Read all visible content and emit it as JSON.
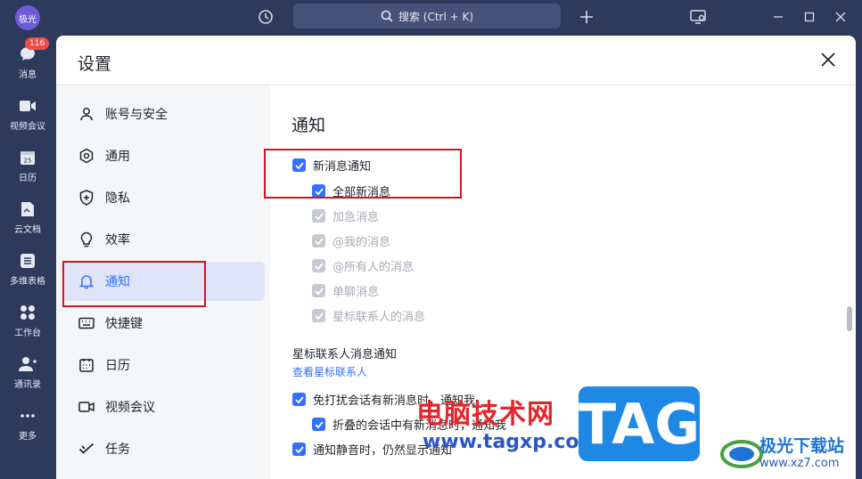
{
  "titlebar": {
    "avatar_text": "极光",
    "history_icon": "history-icon",
    "search_placeholder": "搜索 (Ctrl + K)",
    "add_icon": "plus-icon",
    "cast_icon": "screen-share-icon"
  },
  "rail": {
    "items": [
      {
        "label": "消息",
        "icon": "chat-bubble-icon",
        "badge": "116"
      },
      {
        "label": "视频会议",
        "icon": "video-camera-icon"
      },
      {
        "label": "日历",
        "icon": "calendar-icon",
        "day": "25"
      },
      {
        "label": "云文档",
        "icon": "document-icon"
      },
      {
        "label": "多维表格",
        "icon": "table-icon"
      },
      {
        "label": "工作台",
        "icon": "grid-apps-icon"
      },
      {
        "label": "通讯录",
        "icon": "contacts-icon"
      },
      {
        "label": "更多",
        "icon": "more-dots-icon"
      }
    ]
  },
  "dialog": {
    "title": "设置",
    "nav": [
      {
        "label": "账号与安全",
        "icon": "user-icon"
      },
      {
        "label": "通用",
        "icon": "gear-icon"
      },
      {
        "label": "隐私",
        "icon": "shield-plus-icon"
      },
      {
        "label": "效率",
        "icon": "lightbulb-icon"
      },
      {
        "label": "通知",
        "icon": "bell-icon",
        "active": true
      },
      {
        "label": "快捷键",
        "icon": "keyboard-icon"
      },
      {
        "label": "日历",
        "icon": "calendar-icon"
      },
      {
        "label": "视频会议",
        "icon": "video-camera-icon"
      },
      {
        "label": "任务",
        "icon": "task-check-icon"
      }
    ],
    "content": {
      "section_title": "通知",
      "new_message_notify": "新消息通知",
      "options": [
        {
          "label": "全部新消息",
          "checked": true,
          "disabled": false
        },
        {
          "label": "加急消息",
          "checked": true,
          "disabled": true
        },
        {
          "label": "@我的消息",
          "checked": true,
          "disabled": true
        },
        {
          "label": "@所有人的消息",
          "checked": true,
          "disabled": true
        },
        {
          "label": "单聊消息",
          "checked": true,
          "disabled": true
        },
        {
          "label": "星标联系人的消息",
          "checked": true,
          "disabled": true
        }
      ],
      "star_contact_title": "星标联系人消息通知",
      "view_star_link": "查看星标联系人",
      "dnd_notify": "免打扰会话有新消息时，通知我",
      "folded_notify": "折叠的会话中有新消息时，通知我",
      "mute_notify": "通知静音时，仍然显示通知"
    }
  },
  "watermark": {
    "cn_text": "电脑技术网",
    "url": "www.tagxp.com",
    "tag": "TAG",
    "site_name": "极光下载站",
    "site_url": "www.xz7.com"
  }
}
